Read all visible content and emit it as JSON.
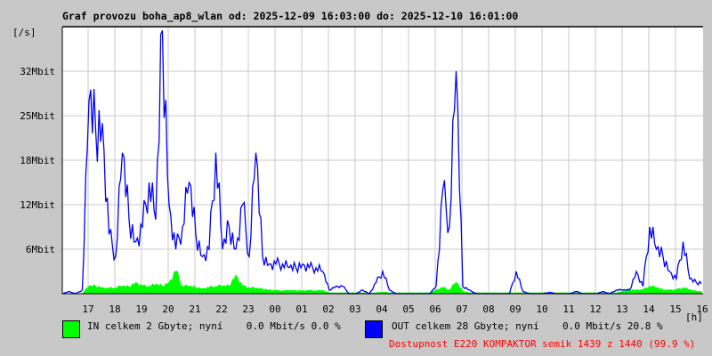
{
  "chart_data": {
    "type": "area",
    "title": "Graf provozu boha_ap8_wlan od: 2025-12-09 16:03:00 do: 2025-12-10 16:01:00",
    "ylabel": "[/s]",
    "xlabel": "[h]",
    "ylim": [
      0,
      36
    ],
    "x_start_hour": 16.05,
    "x_step_hours": 0.25,
    "y_ticks": [
      {
        "value": 6,
        "label": "6Mbit"
      },
      {
        "value": 12,
        "label": "12Mbit"
      },
      {
        "value": 18,
        "label": "18Mbit"
      },
      {
        "value": 24,
        "label": "25Mbit"
      },
      {
        "value": 30,
        "label": "32Mbit"
      }
    ],
    "x_ticks": [
      "17",
      "18",
      "19",
      "20",
      "21",
      "22",
      "23",
      "00",
      "01",
      "02",
      "03",
      "04",
      "05",
      "06",
      "07",
      "08",
      "09",
      "10",
      "11",
      "12",
      "13",
      "14",
      "15",
      "16"
    ],
    "grid": true,
    "series": [
      {
        "name": "IN",
        "color": "#00ff00",
        "style": "area",
        "values": [
          0,
          0,
          0,
          0,
          1,
          1,
          0.8,
          0.7,
          0.8,
          1,
          0.9,
          1.5,
          1,
          1,
          1.2,
          1,
          1.5,
          3,
          1,
          1,
          0.8,
          0.7,
          0.8,
          1,
          1,
          1,
          2.5,
          1,
          0.8,
          0.7,
          0.6,
          0.5,
          0.4,
          0.4,
          0.4,
          0.4,
          0.4,
          0.4,
          0.4,
          0.4,
          0.1,
          0.1,
          0.1,
          0.1,
          0.1,
          0.1,
          0.1,
          0.1,
          0.2,
          0.1,
          0.1,
          0.1,
          0.1,
          0.1,
          0.1,
          0.1,
          0.5,
          0.8,
          0.5,
          1.5,
          0.3,
          0.1,
          0.1,
          0.1,
          0.1,
          0.1,
          0.1,
          0.1,
          0.1,
          0.1,
          0.1,
          0.1,
          0.1,
          0.1,
          0.1,
          0.1,
          0.1,
          0.1,
          0.1,
          0.1,
          0.1,
          0.1,
          0.1,
          0.1,
          0.3,
          0.5,
          0.5,
          0.5,
          1,
          0.8,
          0.5,
          0.5,
          0.5,
          0.8,
          0.5,
          0.3
        ]
      },
      {
        "name": "OUT",
        "color": "#0000ff",
        "style": "line",
        "values": [
          0,
          0.3,
          0,
          0.5,
          26,
          22,
          23,
          8,
          5,
          19,
          10,
          7,
          9,
          15,
          10,
          35.5,
          12,
          6,
          9,
          15,
          8,
          5,
          6,
          19,
          6,
          9,
          6,
          12,
          5,
          19,
          5,
          4,
          4,
          4,
          3.5,
          3.5,
          4,
          3.5,
          3.5,
          3,
          0.5,
          1,
          1,
          0,
          0,
          0.5,
          0,
          1.5,
          3,
          0.5,
          0,
          0,
          0,
          0,
          0,
          0,
          1,
          14,
          9,
          30,
          1,
          0.5,
          0,
          0,
          0,
          0,
          0,
          0,
          3,
          0.3,
          0,
          0,
          0,
          0.2,
          0,
          0,
          0,
          0.3,
          0,
          0,
          0,
          0.3,
          0,
          0.5,
          0.5,
          0.5,
          3,
          1,
          9,
          6,
          5,
          3,
          2,
          7,
          2,
          1.5
        ]
      }
    ]
  },
  "legend": {
    "in_color": "#00ff00",
    "out_color": "#0000ff",
    "in_text": "IN celkem 2 Gbyte; nyní    0.0 Mbit/s 0.0 %",
    "out_text": "OUT celkem 28 Gbyte; nyní    0.0 Mbit/s 20.8 %",
    "availability": "Dostupnost E220 KOMPAKTOR semik 1439 z 1440 (99.9 %)"
  }
}
